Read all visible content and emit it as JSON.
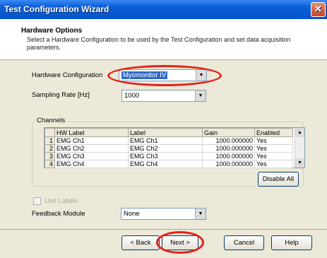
{
  "window": {
    "title": "Test Configuration Wizard",
    "close_glyph": "✕"
  },
  "header": {
    "title": "Hardware Options",
    "description": "Select a Hardware Configuration to be used by the Test Configuration and set data acquisition parameters."
  },
  "hardware_config": {
    "label": "Hardware Configuration",
    "value": "Myomonitor IV"
  },
  "sampling_rate": {
    "label": "Sampling Rate [Hz]",
    "value": "1000"
  },
  "channels": {
    "legend": "Channels",
    "columns": [
      "HW Label",
      "Label",
      "Gain",
      "Enabled"
    ],
    "rows": [
      {
        "n": "1",
        "hw": "EMG Ch1",
        "label": "EMG Ch1",
        "gain": "1000.000000",
        "enabled": "Yes"
      },
      {
        "n": "2",
        "hw": "EMG Ch2",
        "label": "EMG Ch2",
        "gain": "1000.000000",
        "enabled": "Yes"
      },
      {
        "n": "3",
        "hw": "EMG Ch3",
        "label": "EMG Ch3",
        "gain": "1000.000000",
        "enabled": "Yes"
      },
      {
        "n": "4",
        "hw": "EMG Ch4",
        "label": "EMG Ch4",
        "gain": "1000.000000",
        "enabled": "Yes"
      }
    ],
    "disable_all": "Disable All"
  },
  "use_labels": {
    "label": "Use Labels"
  },
  "feedback_module": {
    "label": "Feedback Module",
    "value": "None"
  },
  "buttons": {
    "back": "< Back",
    "next": "Next >",
    "cancel": "Cancel",
    "help": "Help"
  },
  "highlight_color": "#e0231b"
}
